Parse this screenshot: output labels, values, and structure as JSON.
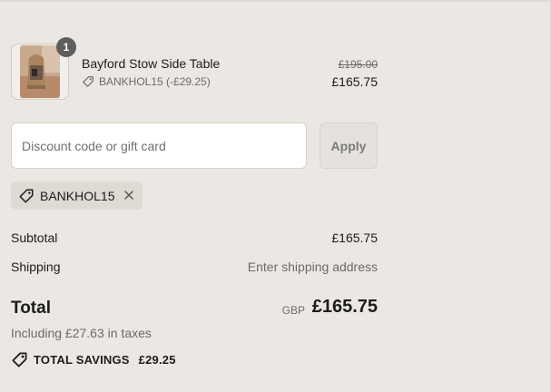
{
  "product": {
    "quantity": "1",
    "name": "Bayford Stow Side Table",
    "discount_line": "BANKHOL15 (-£29.25)",
    "original_price": "£195.00",
    "price": "£165.75"
  },
  "discount": {
    "placeholder": "Discount code or gift card",
    "value": "",
    "apply_label": "Apply",
    "applied_code": "BANKHOL15"
  },
  "summary": {
    "subtotal_label": "Subtotal",
    "subtotal_value": "£165.75",
    "shipping_label": "Shipping",
    "shipping_value": "Enter shipping address",
    "total_label": "Total",
    "currency": "GBP",
    "total_value": "£165.75",
    "taxes_note": "Including £27.63 in taxes",
    "savings_label": "TOTAL SAVINGS",
    "savings_value": "£29.25"
  },
  "icons": {
    "tag": "tag-icon",
    "close": "close-icon"
  },
  "colors": {
    "background": "#ebe8e3",
    "badge": "#5e5e5e",
    "muted_text": "#6b6b6b"
  }
}
